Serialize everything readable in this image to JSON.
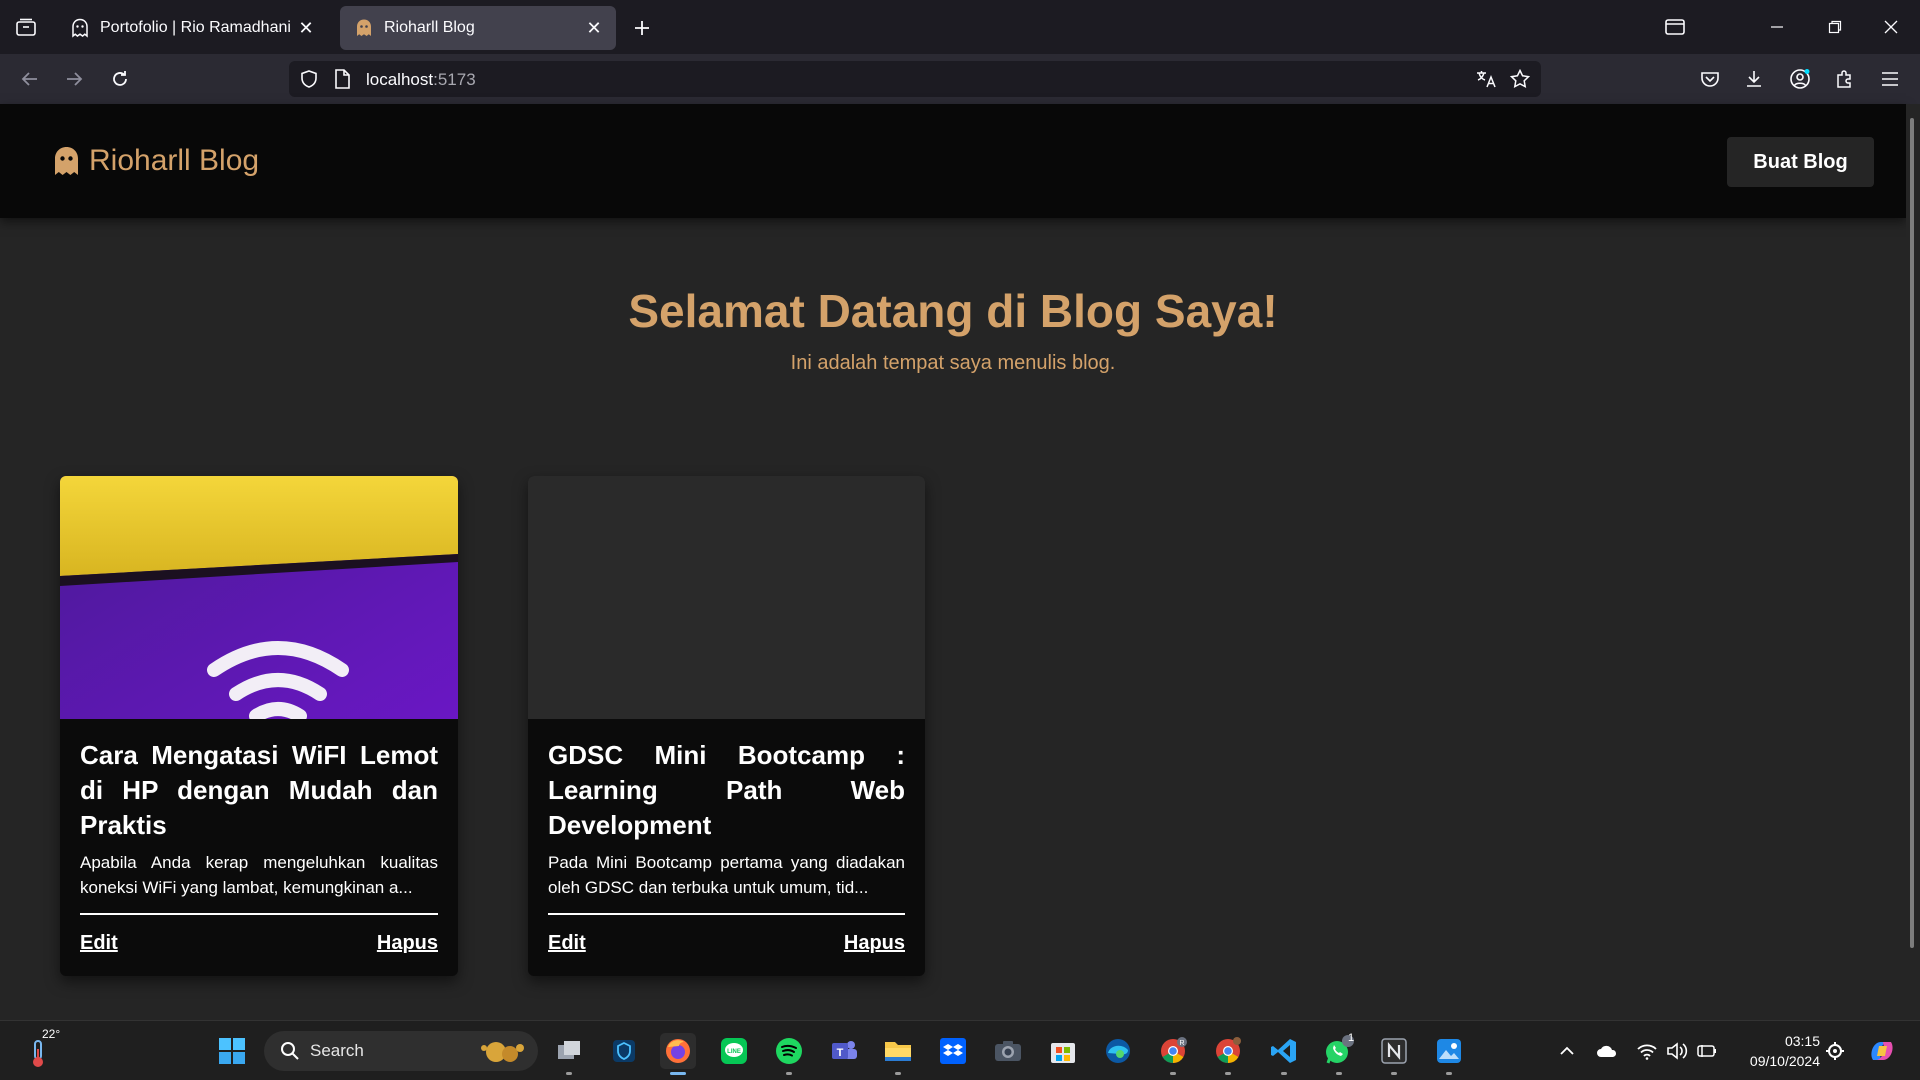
{
  "browser": {
    "tabs": [
      {
        "title": "Portofolio | Rio Ramadhani Har",
        "active": false
      },
      {
        "title": "Rioharll Blog",
        "active": true
      }
    ],
    "url": {
      "host": "localhost",
      "port": ":5173"
    }
  },
  "site": {
    "brand": "Rioharll Blog",
    "create_button": "Buat Blog",
    "hero_title": "Selamat Datang di Blog Saya!",
    "hero_subtitle": "Ini adalah tempat saya menulis blog.",
    "accent_color": "#d4a26a"
  },
  "posts": [
    {
      "title": "Cara Mengatasi WiFI Lemot di HP dengan Mudah dan Praktis",
      "excerpt": "Apabila Anda kerap mengeluhkan kualitas koneksi WiFi yang lambat, kemungkinan a...",
      "edit_label": "Edit",
      "delete_label": "Hapus",
      "thumbnail": "wifi-icon-image"
    },
    {
      "title": "GDSC Mini Bootcamp : Learning Path Web Development",
      "excerpt": "Pada Mini Bootcamp pertama yang diadakan oleh GDSC dan terbuka untuk umum, tid...",
      "edit_label": "Edit",
      "delete_label": "Hapus",
      "thumbnail": "blank-image"
    }
  ],
  "taskbar": {
    "weather_temp": "22°",
    "search_label": "Search",
    "time": "03:15",
    "date": "09/10/2024",
    "whatsapp_badge": "1",
    "apps": [
      "windows-start",
      "task-view",
      "unknown-app",
      "firefox",
      "line",
      "spotify",
      "teams",
      "file-explorer",
      "dropbox",
      "camera",
      "store",
      "edge",
      "chrome",
      "chrome-profile",
      "vscode",
      "whatsapp",
      "notion",
      "photos"
    ]
  }
}
